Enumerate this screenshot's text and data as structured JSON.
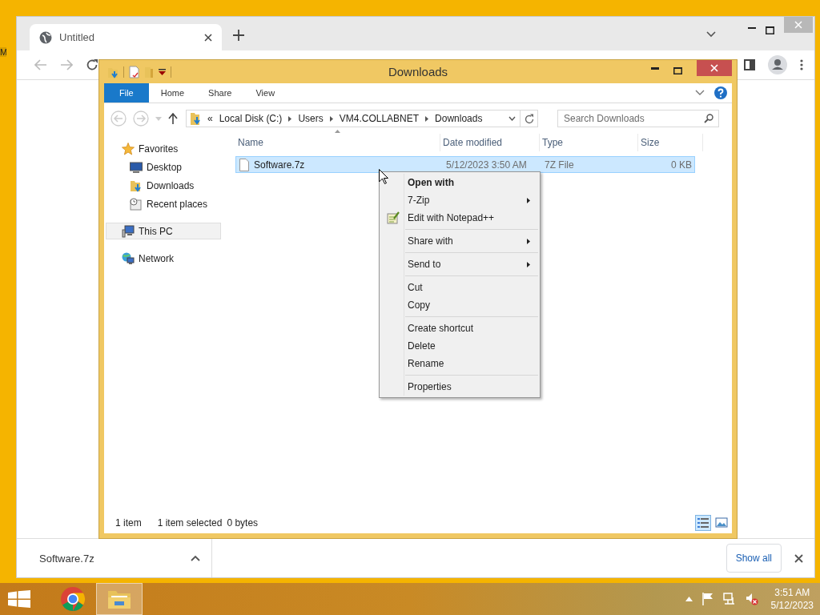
{
  "desktop": {
    "icon_label": "M"
  },
  "browser": {
    "tabs": [
      {
        "title": "Untitled",
        "selected": true
      }
    ],
    "download_bar": {
      "items": [
        {
          "name": "Software.7z"
        }
      ],
      "show_all": "Show all"
    }
  },
  "explorer": {
    "title": "Downloads",
    "ribbon_tabs": [
      {
        "label": "File",
        "kind": "file"
      },
      {
        "label": "Home",
        "kind": "tab"
      },
      {
        "label": "Share",
        "kind": "tab"
      },
      {
        "label": "View",
        "kind": "tab"
      }
    ],
    "address": {
      "overflow": "«",
      "breadcrumbs": [
        "Local Disk (C:)",
        "Users",
        "VM4.COLLABNET",
        "Downloads"
      ]
    },
    "search": {
      "placeholder": "Search Downloads"
    },
    "navigation": [
      {
        "label": "Favorites",
        "kind": "favorites",
        "selected": false,
        "children": [
          {
            "label": "Desktop",
            "kind": "desktop",
            "selected": false
          },
          {
            "label": "Downloads",
            "kind": "downloads",
            "selected": false
          },
          {
            "label": "Recent places",
            "kind": "recent",
            "selected": false
          }
        ]
      },
      {
        "label": "This PC",
        "kind": "pc",
        "selected": true
      },
      {
        "label": "Network",
        "kind": "network",
        "selected": false
      }
    ],
    "file_list": {
      "columns": [
        "Name",
        "Date modified",
        "Type",
        "Size"
      ],
      "rows": [
        {
          "name": "Software.7z",
          "date_modified": "5/12/2023 3:50 AM",
          "type": "7Z File",
          "size": "0 KB",
          "selected": true
        }
      ]
    },
    "status_bar": {
      "item_count": "1 item",
      "selection": "1 item selected",
      "selection_size": "0 bytes"
    },
    "view_buttons": [
      {
        "kind": "details",
        "selected": true
      },
      {
        "kind": "large_icons",
        "selected": false
      }
    ]
  },
  "context_menu": {
    "items": [
      {
        "kind": "item",
        "label": "Open with",
        "default": true,
        "submenu": false,
        "has_icon": false
      },
      {
        "kind": "item",
        "label": "7-Zip",
        "default": false,
        "submenu": true,
        "has_icon": false
      },
      {
        "kind": "item",
        "label": "Edit with Notepad++",
        "default": false,
        "submenu": false,
        "has_icon": true
      },
      {
        "kind": "separator"
      },
      {
        "kind": "item",
        "label": "Share with",
        "default": false,
        "submenu": true,
        "has_icon": false
      },
      {
        "kind": "separator"
      },
      {
        "kind": "item",
        "label": "Send to",
        "default": false,
        "submenu": true,
        "has_icon": false
      },
      {
        "kind": "separator"
      },
      {
        "kind": "item",
        "label": "Cut",
        "default": false,
        "submenu": false,
        "has_icon": false
      },
      {
        "kind": "item",
        "label": "Copy",
        "default": false,
        "submenu": false,
        "has_icon": false
      },
      {
        "kind": "separator"
      },
      {
        "kind": "item",
        "label": "Create shortcut",
        "default": false,
        "submenu": false,
        "has_icon": false
      },
      {
        "kind": "item",
        "label": "Delete",
        "default": false,
        "submenu": false,
        "has_icon": false
      },
      {
        "kind": "item",
        "label": "Rename",
        "default": false,
        "submenu": false,
        "has_icon": false
      },
      {
        "kind": "separator"
      },
      {
        "kind": "item",
        "label": "Properties",
        "default": false,
        "submenu": false,
        "has_icon": false
      }
    ]
  },
  "taskbar": {
    "apps": [
      {
        "kind": "chrome",
        "active": false
      },
      {
        "kind": "explorer",
        "active": true
      }
    ],
    "clock": {
      "time": "3:51 AM",
      "date": "5/12/2023"
    }
  }
}
